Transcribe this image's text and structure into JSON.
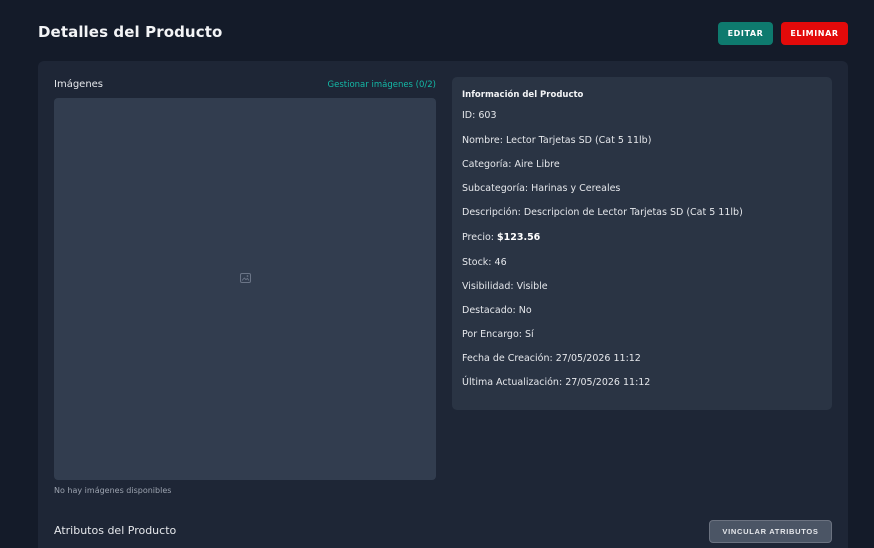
{
  "header": {
    "title": "Detalles del Producto",
    "edit_label": "EDITAR",
    "delete_label": "ELIMINAR"
  },
  "colors": {
    "edit_button": "#0e7a6e",
    "delete_button": "#e30a0a",
    "accent_link": "#14b8a6"
  },
  "images": {
    "label": "Imágenes",
    "manage_link": "Gestionar imágenes (0/2)",
    "placeholder_icon": "image-icon",
    "empty_text": "No hay imágenes disponibles"
  },
  "info": {
    "title": "Información del Producto",
    "rows": [
      {
        "label": "ID:",
        "value": "603"
      },
      {
        "label": "Nombre:",
        "value": "Lector Tarjetas SD (Cat 5 11lb)"
      },
      {
        "label": "Categoría:",
        "value": "Aire Libre"
      },
      {
        "label": "Subcategoría:",
        "value": "Harinas y Cereales"
      },
      {
        "label": "Descripción:",
        "value": "Descripcion de Lector Tarjetas SD (Cat 5 11lb)"
      },
      {
        "label": "Precio:",
        "value": "$123.56"
      },
      {
        "label": "Stock:",
        "value": "46"
      },
      {
        "label": "Visibilidad:",
        "value": "Visible"
      },
      {
        "label": "Destacado:",
        "value": "No"
      },
      {
        "label": "Por Encargo:",
        "value": "Sí"
      },
      {
        "label": "Fecha de Creación:",
        "value": "27/05/2026 11:12"
      },
      {
        "label": "Última Actualización:",
        "value": "27/05/2026 11:12"
      }
    ]
  },
  "attributes": {
    "title": "Atributos del Producto",
    "link_button": "VINCULAR ATRIBUTOS"
  }
}
